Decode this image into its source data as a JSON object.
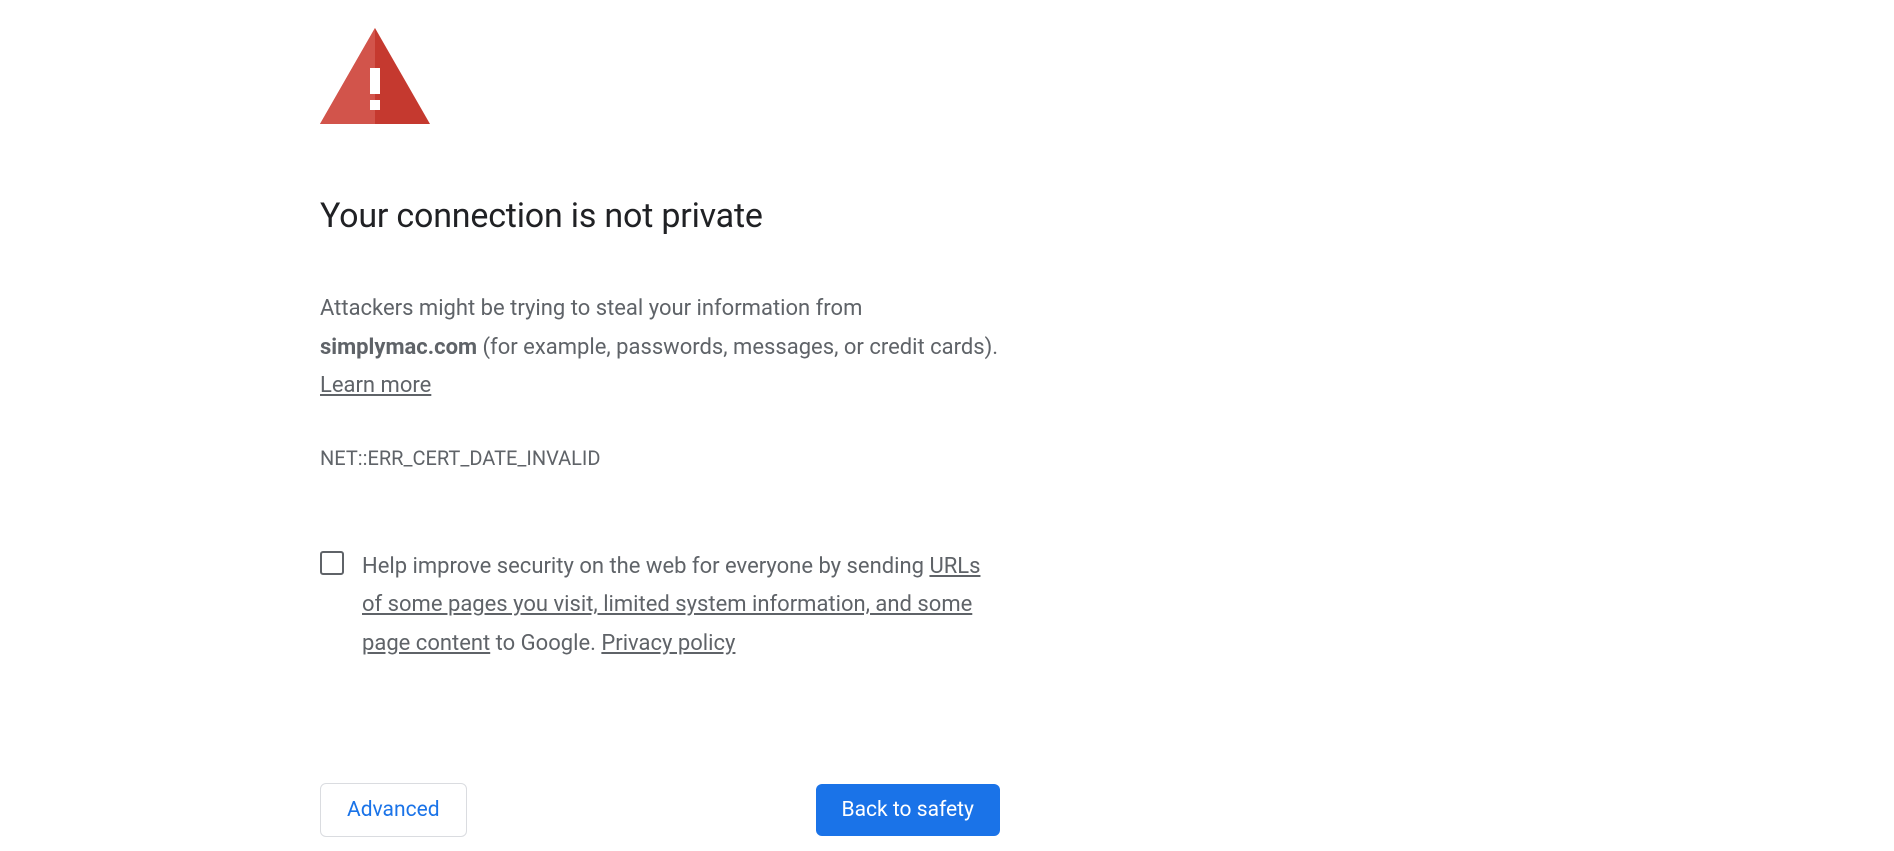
{
  "heading": "Your connection is not private",
  "message": {
    "prefix": "Attackers might be trying to steal your information from ",
    "domain": "simplymac.com",
    "suffix": " (for example, passwords, messages, or credit cards). ",
    "learn_more": "Learn more"
  },
  "error_code": "NET::ERR_CERT_DATE_INVALID",
  "optin": {
    "prefix": "Help improve security on the web for everyone by sending ",
    "link1": "URLs of some pages you visit, limited system information, and some page content",
    "mid": " to Google. ",
    "link2": "Privacy policy"
  },
  "buttons": {
    "advanced": "Advanced",
    "back": "Back to safety"
  }
}
